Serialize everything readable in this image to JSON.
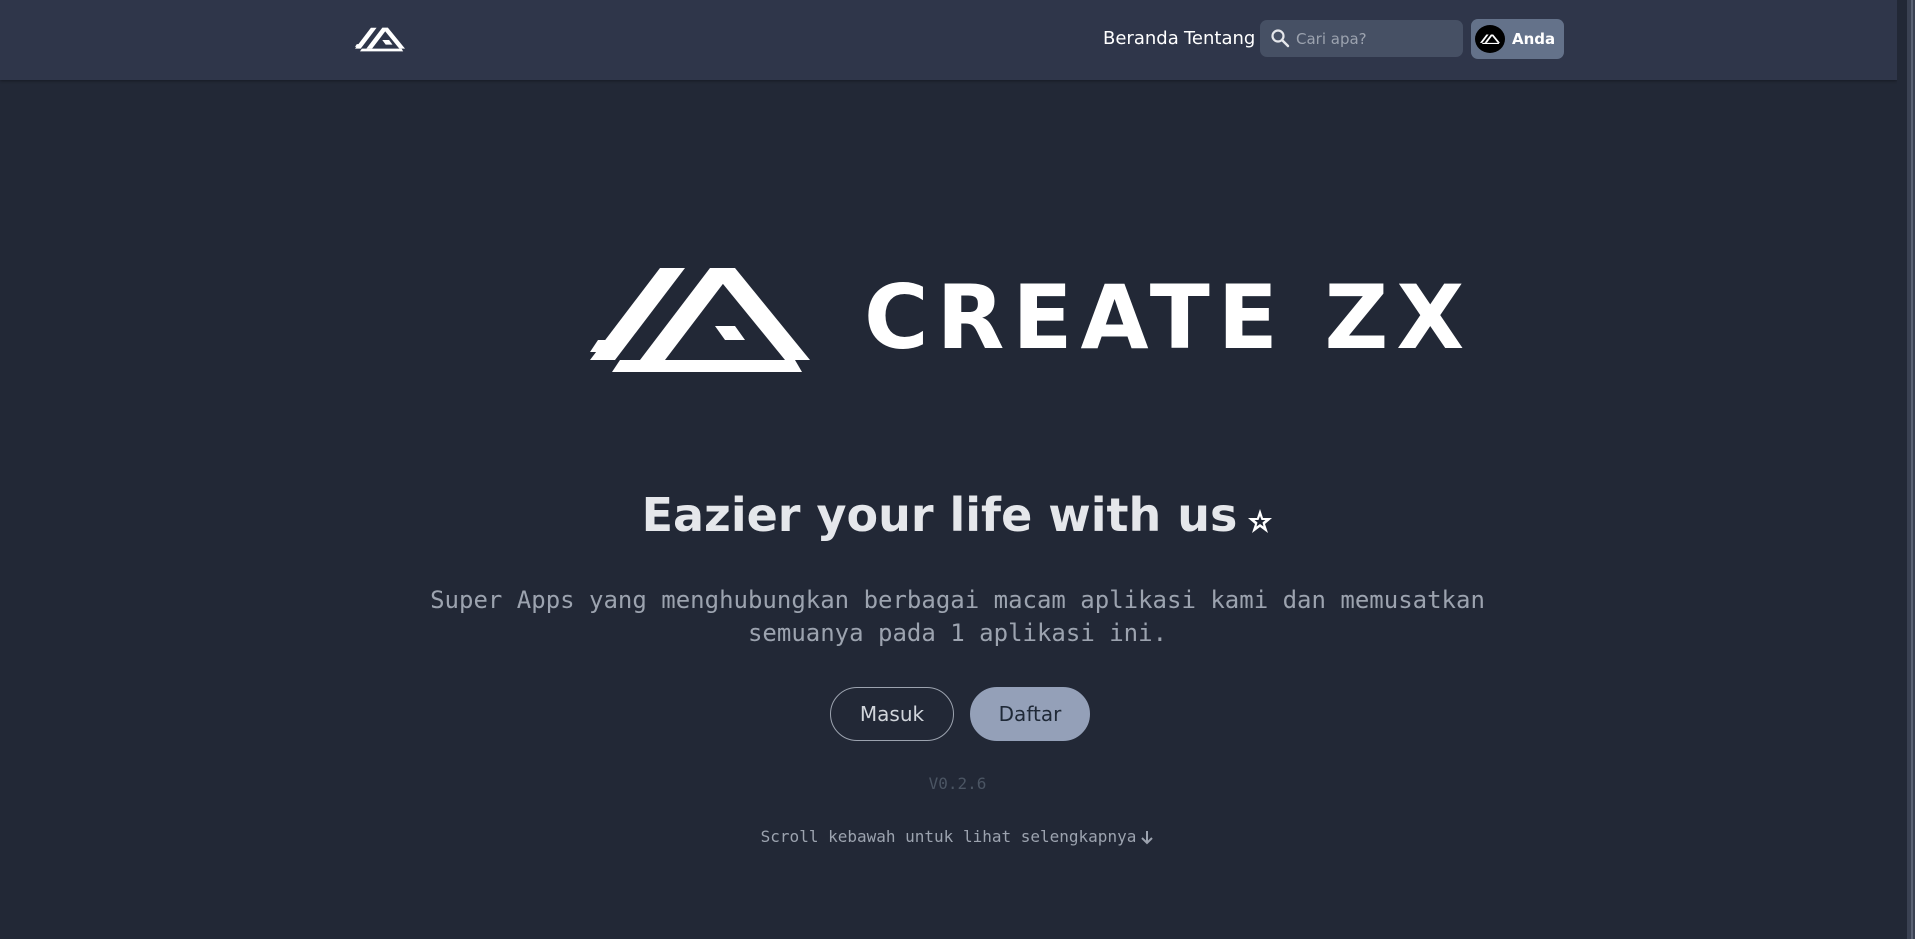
{
  "navbar": {
    "logo_icon": "create-zx-logo-icon",
    "links": {
      "home": "Beranda",
      "about": "Tentang"
    },
    "search": {
      "icon": "search-icon",
      "placeholder": "Cari apa?",
      "value": ""
    },
    "user": {
      "avatar_icon": "create-zx-logo-icon",
      "label": "Anda"
    }
  },
  "hero": {
    "brand": "CREATE ZX",
    "tagline": "Eazier your life with us",
    "tagline_icon": "sparkle-star-icon",
    "description": "Super Apps yang menghubungkan berbagai macam aplikasi kami dan memusatkan semuanya pada 1 aplikasi ini.",
    "buttons": {
      "login": "Masuk",
      "register": "Daftar"
    },
    "version": "V0.2.6",
    "scroll_hint": "Scroll kebawah untuk lihat selengkapnya",
    "scroll_icon": "arrow-down-icon"
  },
  "colors": {
    "background": "#222836",
    "navbar": "#2f364a",
    "search_bg": "#465064",
    "user_button": "#64728a",
    "primary_button": "#94a0b8"
  }
}
